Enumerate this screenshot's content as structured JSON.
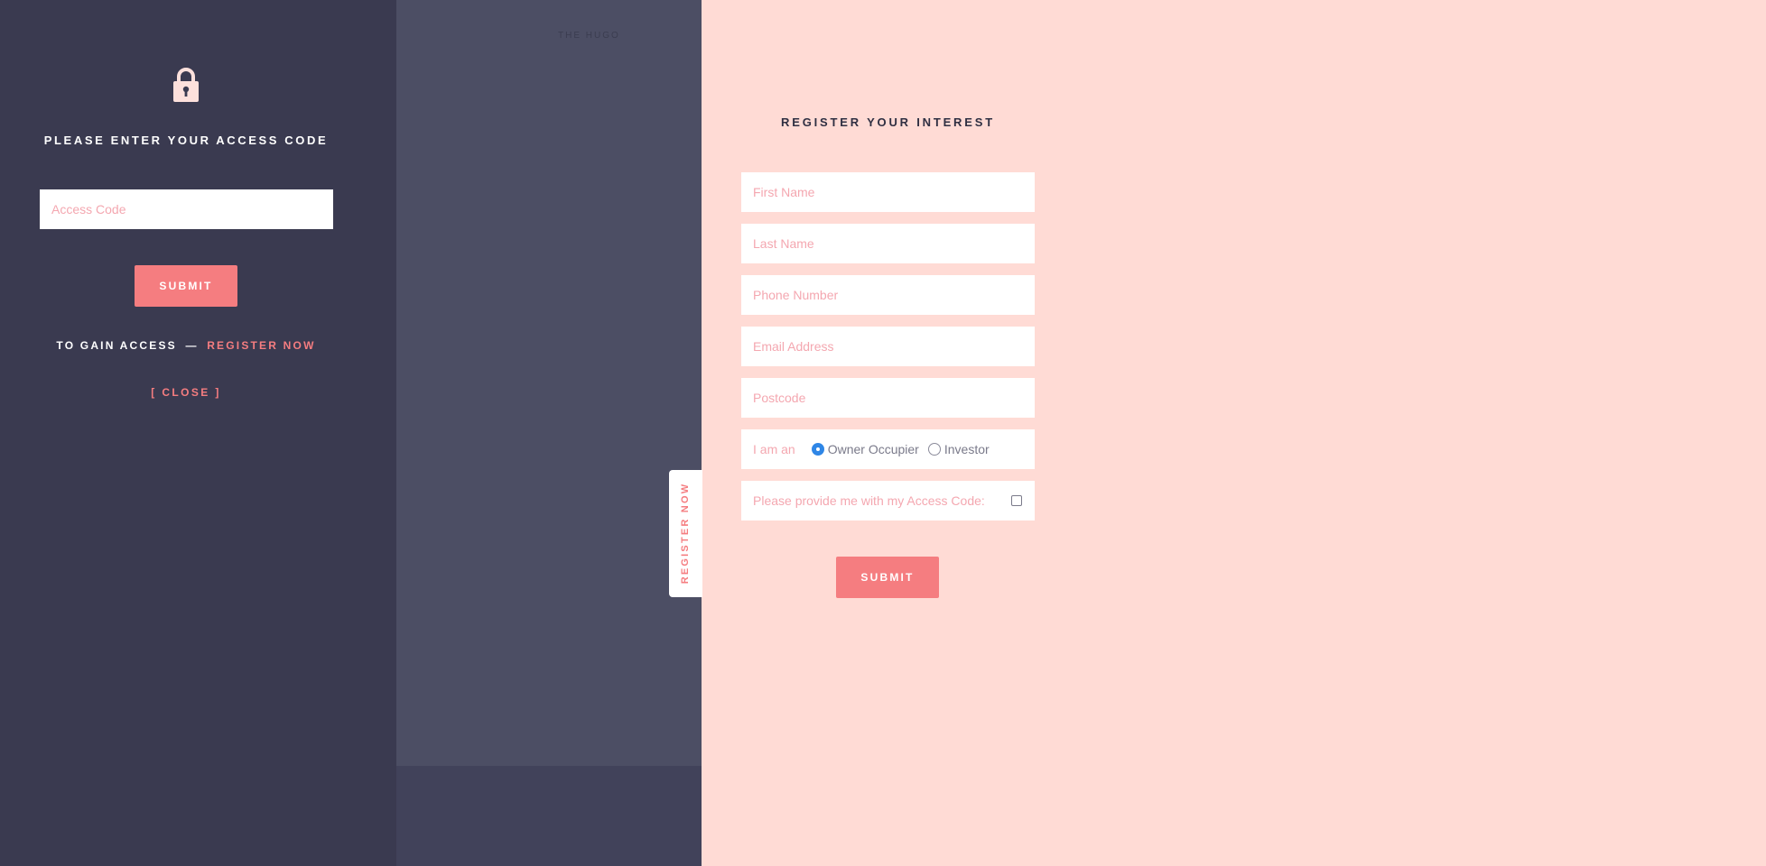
{
  "access": {
    "lock_icon": "lock-icon",
    "title": "PLEASE ENTER YOUR ACCESS CODE",
    "input_placeholder": "Access Code",
    "submit_label": "SUBMIT",
    "gain_text": "TO GAIN ACCESS",
    "dash": "—",
    "register_link": "REGISTER NOW",
    "close_label": "[ CLOSE ]"
  },
  "brand": "THE HUGO",
  "register_tab": {
    "label": "REGISTER NOW"
  },
  "form": {
    "title": "REGISTER YOUR INTEREST",
    "first_name_placeholder": "First Name",
    "last_name_placeholder": "Last Name",
    "phone_placeholder": "Phone Number",
    "email_placeholder": "Email Address",
    "postcode_placeholder": "Postcode",
    "radio_prefix": "I am an",
    "radio_options": [
      {
        "label": "Owner Occupier",
        "checked": true
      },
      {
        "label": "Investor",
        "checked": false
      }
    ],
    "access_code_request_label": "Please provide me with my Access Code:",
    "access_code_request_checked": false,
    "submit_label": "SUBMIT"
  },
  "colors": {
    "left_panel": "#3a3a50",
    "middle_panel": "#4c4e64",
    "form_background": "#ffdbd5",
    "accent": "#f57d80",
    "placeholder": "#f4a7b0",
    "radio_selected": "#2f86e6"
  }
}
